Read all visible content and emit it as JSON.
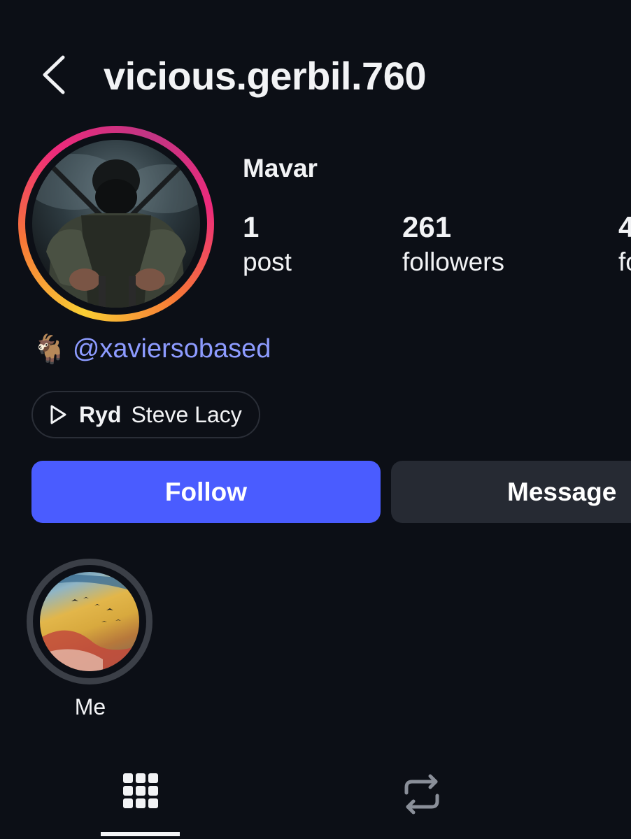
{
  "header": {
    "username": "vicious.gerbil.760",
    "back_icon": "chevron-left-icon"
  },
  "profile": {
    "display_name": "Mavar",
    "stats": {
      "posts": {
        "value": "1",
        "label": "post"
      },
      "followers": {
        "value": "261",
        "label": "followers"
      },
      "following": {
        "value": "4",
        "label": "fo"
      }
    },
    "bio": {
      "emoji": "🐐",
      "mention": "@xaviersobased"
    },
    "music": {
      "icon": "play-icon",
      "title": "Ryd",
      "artist": "Steve Lacy"
    }
  },
  "actions": {
    "follow_label": "Follow",
    "message_label": "Message"
  },
  "highlights": [
    {
      "label": "Me"
    }
  ],
  "tabs": [
    {
      "icon": "grid-icon",
      "active": true
    },
    {
      "icon": "repost-icon",
      "active": false
    }
  ],
  "colors": {
    "background": "#0c0f16",
    "follow_button": "#4a5cff",
    "message_button": "#262a33",
    "mention": "#8d9bff",
    "text": "#f2f3f5"
  }
}
